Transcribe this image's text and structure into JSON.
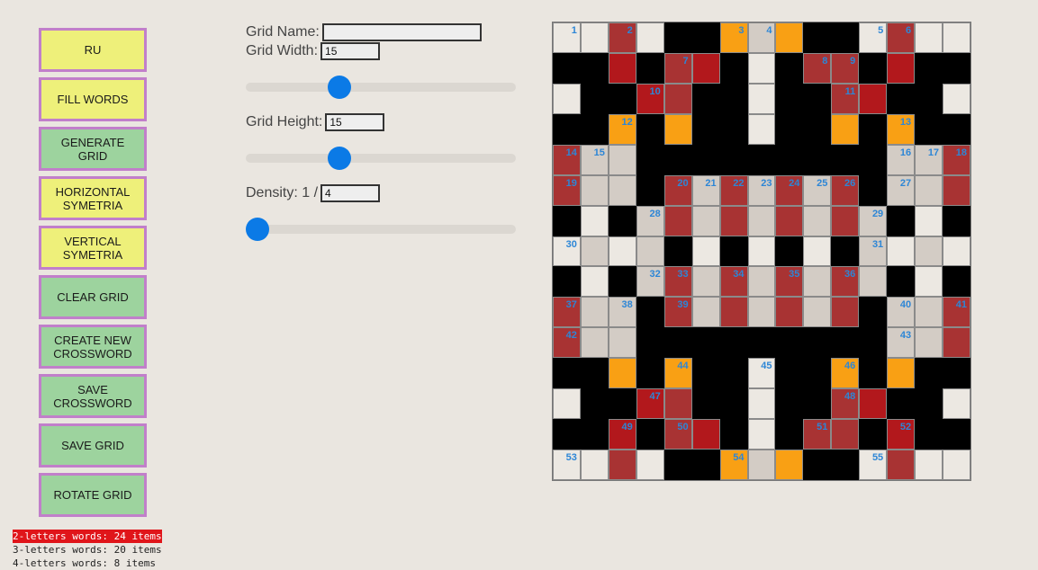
{
  "buttons": [
    {
      "label": "RU",
      "color": "yellow",
      "name": "ru-button"
    },
    {
      "label": "FILL WORDS",
      "color": "yellow",
      "name": "fill-words-button"
    },
    {
      "label": "GENERATE GRID",
      "color": "green",
      "name": "generate-grid-button"
    },
    {
      "label": "HORIZONTAL SYMETRIA",
      "color": "yellow",
      "name": "horizontal-symetria-button"
    },
    {
      "label": "VERTICAL SYMETRIA",
      "color": "yellow",
      "name": "vertical-symetria-button"
    },
    {
      "label": "CLEAR GRID",
      "color": "green",
      "name": "clear-grid-button"
    },
    {
      "label": "CREATE NEW CROSSWORD",
      "color": "green",
      "name": "create-new-crossword-button"
    },
    {
      "label": "SAVE CROSSWORD",
      "color": "green",
      "name": "save-crossword-button"
    },
    {
      "label": "SAVE GRID",
      "color": "green",
      "name": "save-grid-button"
    },
    {
      "label": "ROTATE GRID",
      "color": "green",
      "name": "rotate-grid-button"
    }
  ],
  "form": {
    "grid_name_label": "Grid Name:",
    "grid_name_value": "",
    "grid_width_label": "Grid Width:",
    "grid_width_value": "15",
    "grid_width_slider": {
      "min": 3,
      "max": 39,
      "value": 15
    },
    "grid_height_label": "Grid Height:",
    "grid_height_value": "15",
    "grid_height_slider": {
      "min": 3,
      "max": 39,
      "value": 15
    },
    "density_label": "Density: 1 /",
    "density_value": "4",
    "density_slider": {
      "min": 4,
      "max": 10,
      "value": 4
    }
  },
  "stats": [
    "2-letters words: 24 items",
    "3-letters words: 20 items",
    "4-letters words: 8 items"
  ],
  "colors": {
    "black": "#000000",
    "white": "#ece8e2",
    "gray": "#d3ccc5",
    "red": "#a83333",
    "dark_red": "#b2181c",
    "orange": "#f9a014",
    "number": "#2d86d6",
    "button_border": "#c17fca",
    "button_yellow": "#eef07a",
    "button_green": "#9dd39e",
    "slider": "#0b7ae6"
  },
  "grid": {
    "width": 15,
    "height": 15,
    "rows": [
      "WWRWBBOGOBBWRWW",
      "BBDBRDBWBRRBDBB",
      "WBBDRBBWBBRDBBW",
      "BBOBOBBWBBOBOBB",
      "RGGBBBBBBBBBGGR",
      "RGGBRGRGRGRBGGR",
      "BWBGRGRGRGRGBWB",
      "WGWGBWBWBWBGWGW",
      "BWBGRGRGRGRGBWB",
      "RGGBRGRGRGRBGGR",
      "RGGBBBBBBBBBGGR",
      "BBOBOBBWBBOBOBB",
      "WBBDRBBWBBRDBBW",
      "BBDBRDBWBRRBDBB",
      "WWRWBBOGOBBWRWW"
    ],
    "numbers": [
      [
        0,
        0,
        1
      ],
      [
        0,
        2,
        2
      ],
      [
        0,
        6,
        3
      ],
      [
        0,
        7,
        4
      ],
      [
        0,
        11,
        5
      ],
      [
        0,
        12,
        6
      ],
      [
        1,
        4,
        7
      ],
      [
        1,
        9,
        8
      ],
      [
        1,
        10,
        9
      ],
      [
        2,
        3,
        10
      ],
      [
        2,
        10,
        11
      ],
      [
        3,
        2,
        12
      ],
      [
        3,
        12,
        13
      ],
      [
        4,
        0,
        14
      ],
      [
        4,
        1,
        15
      ],
      [
        4,
        12,
        16
      ],
      [
        4,
        13,
        17
      ],
      [
        4,
        14,
        18
      ],
      [
        5,
        0,
        19
      ],
      [
        5,
        4,
        20
      ],
      [
        5,
        5,
        21
      ],
      [
        5,
        6,
        22
      ],
      [
        5,
        7,
        23
      ],
      [
        5,
        8,
        24
      ],
      [
        5,
        9,
        25
      ],
      [
        5,
        10,
        26
      ],
      [
        5,
        12,
        27
      ],
      [
        6,
        3,
        28
      ],
      [
        6,
        11,
        29
      ],
      [
        7,
        0,
        30
      ],
      [
        7,
        11,
        31
      ],
      [
        8,
        3,
        32
      ],
      [
        8,
        4,
        33
      ],
      [
        8,
        6,
        34
      ],
      [
        8,
        8,
        35
      ],
      [
        8,
        10,
        36
      ],
      [
        9,
        0,
        37
      ],
      [
        9,
        2,
        38
      ],
      [
        9,
        4,
        39
      ],
      [
        9,
        12,
        40
      ],
      [
        9,
        14,
        41
      ],
      [
        10,
        0,
        42
      ],
      [
        10,
        12,
        43
      ],
      [
        11,
        4,
        44
      ],
      [
        11,
        7,
        45
      ],
      [
        11,
        10,
        46
      ],
      [
        12,
        3,
        47
      ],
      [
        12,
        10,
        48
      ],
      [
        13,
        2,
        49
      ],
      [
        13,
        4,
        50
      ],
      [
        13,
        9,
        51
      ],
      [
        13,
        12,
        52
      ],
      [
        14,
        0,
        53
      ],
      [
        14,
        6,
        54
      ],
      [
        14,
        11,
        55
      ]
    ]
  }
}
